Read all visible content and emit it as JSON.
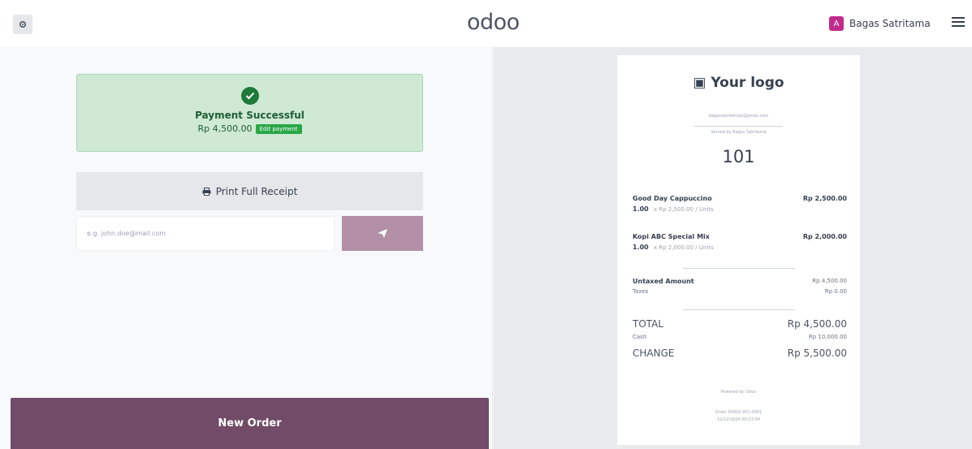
{
  "header": {
    "brand": "odoo",
    "user_initial": "A",
    "user_name": "Bagas Satritama",
    "avatar_color": "#c02b8c"
  },
  "payment": {
    "status_title": "Payment Successful",
    "amount": "Rp 4,500.00",
    "edit_label": "Edit payment",
    "print_label": "Print Full Receipt",
    "email_placeholder": "e.g. john.doe@mail.com",
    "new_order_label": "New Order",
    "accent_color": "#714b67"
  },
  "receipt": {
    "logo": "Your logo",
    "email": "bagassatritama1@gmail.com",
    "served_by": "Served by Bagas Satritama",
    "order_number": "101",
    "lines": [
      {
        "name": "Good Day Cappuccino",
        "price": "Rp 2,500.00",
        "qty": "1.00",
        "unit": "x Rp 2,500.00 / Units"
      },
      {
        "name": "Kopi ABC Special Mix",
        "price": "Rp 2,000.00",
        "qty": "1.00",
        "unit": "x Rp 2,000.00 / Units"
      }
    ],
    "untaxed_label": "Untaxed Amount",
    "untaxed_value": "Rp 4,500.00",
    "taxes_label": "Taxes",
    "taxes_value": "Rp 0.00",
    "total_label": "TOTAL",
    "total_value": "Rp 4,500.00",
    "cash_label": "Cash",
    "cash_value": "Rp 10,000.00",
    "change_label": "CHANGE",
    "change_value": "Rp 5,500.00",
    "powered_by": "Powered by Odoo",
    "order_ref": "Order 00001-001-0001",
    "datetime": "12/12/2024 00:23:04"
  }
}
